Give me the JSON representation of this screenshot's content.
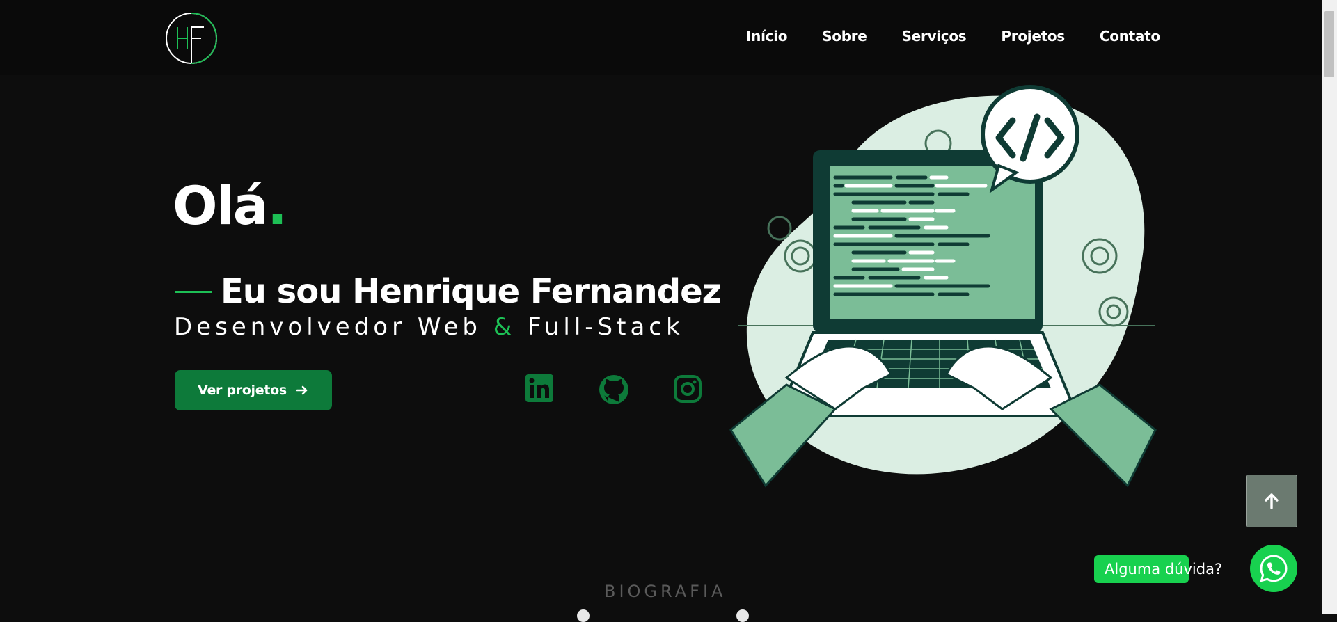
{
  "brand": {
    "logo_text": "HF",
    "accent": "#1dbf55"
  },
  "nav": {
    "items": [
      "Início",
      "Sobre",
      "Serviços",
      "Projetos",
      "Contato"
    ]
  },
  "hero": {
    "greeting": "Olá",
    "greeting_dot": ".",
    "intro": "Eu sou Henrique Fernandez",
    "role_part1": "Desenvolvedor Web",
    "role_amp": "&",
    "role_part2": "Full-Stack",
    "cta_label": "Ver projetos",
    "social": [
      "linkedin-icon",
      "github-icon",
      "instagram-icon"
    ]
  },
  "illustration": {
    "code_tag": "</>"
  },
  "floating": {
    "whatsapp_label": "Alguma dúvida?",
    "scroll_top_icon": "arrow-up-icon"
  },
  "next_section": {
    "label": "BIOGRAFIA"
  },
  "colors": {
    "background": "#0d0d0d",
    "green": "#1dbf55",
    "button": "#0d7a3a",
    "whatsapp": "#18d14f",
    "illustration_green": "#7bbd97"
  }
}
